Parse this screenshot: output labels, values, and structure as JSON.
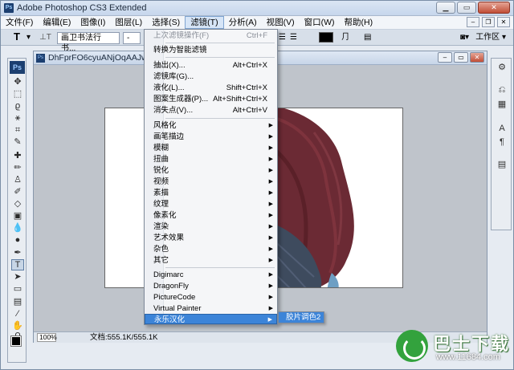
{
  "app": {
    "title": "Adobe Photoshop CS3 Extended",
    "icon": "ps-icon",
    "window_buttons": [
      "minimize",
      "maximize",
      "close"
    ]
  },
  "menubar": {
    "items": [
      {
        "label": "文件(F)"
      },
      {
        "label": "编辑(E)"
      },
      {
        "label": "图像(I)"
      },
      {
        "label": "图层(L)"
      },
      {
        "label": "选择(S)"
      },
      {
        "label": "滤镜(T)",
        "active": true
      },
      {
        "label": "分析(A)"
      },
      {
        "label": "视图(V)"
      },
      {
        "label": "窗口(W)"
      },
      {
        "label": "帮助(H)"
      }
    ]
  },
  "options_bar": {
    "tool_glyph": "T",
    "font_family": "画卫书法行书...",
    "font_style": "-",
    "workspace_label": "工作区"
  },
  "toolbox": {
    "logo": "Ps"
  },
  "document": {
    "title": "DhFprFO6cyuANjOqAAJwn_V8n",
    "zoom": "100%",
    "doc_info": "文档:555.1K/555.1K"
  },
  "filter_menu": {
    "items": [
      {
        "label": "上次滤镜操作(F)",
        "shortcut": "Ctrl+F",
        "disabled": true
      },
      {
        "separator": true
      },
      {
        "label": "转换为智能滤镜"
      },
      {
        "separator": true
      },
      {
        "label": "抽出(X)...",
        "shortcut": "Alt+Ctrl+X"
      },
      {
        "label": "滤镜库(G)..."
      },
      {
        "label": "液化(L)...",
        "shortcut": "Shift+Ctrl+X"
      },
      {
        "label": "图案生成器(P)...",
        "shortcut": "Alt+Shift+Ctrl+X"
      },
      {
        "label": "消失点(V)...",
        "shortcut": "Alt+Ctrl+V"
      },
      {
        "separator": true
      },
      {
        "label": "风格化",
        "submenu": true
      },
      {
        "label": "画笔描边",
        "submenu": true
      },
      {
        "label": "模糊",
        "submenu": true
      },
      {
        "label": "扭曲",
        "submenu": true
      },
      {
        "label": "锐化",
        "submenu": true
      },
      {
        "label": "视频",
        "submenu": true
      },
      {
        "label": "素描",
        "submenu": true
      },
      {
        "label": "纹理",
        "submenu": true
      },
      {
        "label": "像素化",
        "submenu": true
      },
      {
        "label": "渲染",
        "submenu": true
      },
      {
        "label": "艺术效果",
        "submenu": true
      },
      {
        "label": "杂色",
        "submenu": true
      },
      {
        "label": "其它",
        "submenu": true
      },
      {
        "separator": true
      },
      {
        "label": "Digimarc",
        "submenu": true
      },
      {
        "label": "DragonFly",
        "submenu": true
      },
      {
        "label": "PictureCode",
        "submenu": true
      },
      {
        "label": "Virtual Painter",
        "submenu": true
      },
      {
        "label": "永乐汉化",
        "submenu": true,
        "highlighted": true
      }
    ]
  },
  "submenu": {
    "label": "胶片调色2"
  },
  "watermark": {
    "name": "巴士下载",
    "url": "www.11684.com"
  },
  "colors": {
    "menu_highlight": "#3c84d8",
    "ps_blue": "#1c3f70",
    "hair": "#6b2a34",
    "jacket": "#3e4b5e",
    "watermark_green": "#33a23d"
  }
}
